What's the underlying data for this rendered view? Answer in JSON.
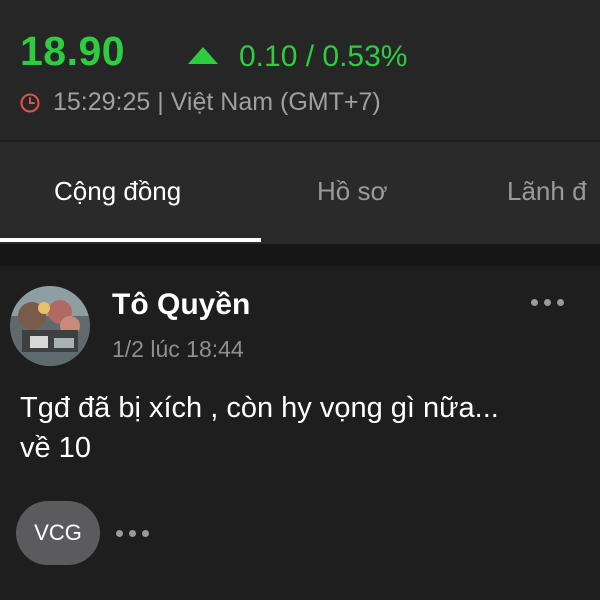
{
  "quote": {
    "price": "18.90",
    "change": "0.10 / 0.53%",
    "time": "15:29:25 | Việt Nam (GMT+7)",
    "up_color": "#2ecc40",
    "clock_icon": "clock-icon",
    "trend_icon": "triangle-up-icon"
  },
  "tabs": [
    {
      "label": "Cộng đồng",
      "active": true
    },
    {
      "label": "Hồ sơ",
      "active": false
    },
    {
      "label": "Lãnh đ",
      "active": false
    }
  ],
  "post": {
    "author": "Tô Quyền",
    "timestamp": "1/2 lúc 18:44",
    "content_line1": "Tgđ đã bị xích , còn hy vọng gì nữa...",
    "content_line2": "về 10",
    "ticker": "VCG",
    "more_icon": "more-horizontal-icon"
  }
}
